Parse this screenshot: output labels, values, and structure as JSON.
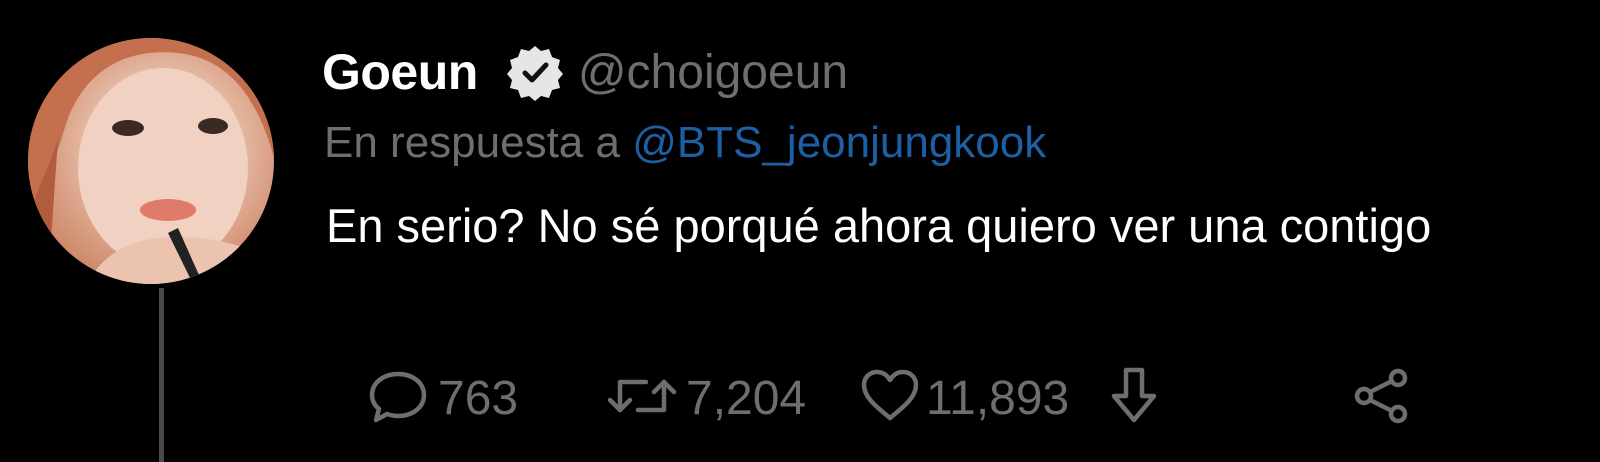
{
  "tweet": {
    "author": {
      "display_name": "Goeun",
      "handle": "@choigoeun",
      "verified": true
    },
    "reply_prefix": "En respuesta a",
    "reply_to": "@BTS_jeonjungkook",
    "text": "En serio? No sé porqué ahora quiero ver una contigo",
    "stats": {
      "replies": "763",
      "retweets": "7,204",
      "likes": "11,893"
    }
  },
  "colors": {
    "background": "#000000",
    "text": "#ffffff",
    "muted": "#6e6e6e",
    "link": "#1d5fa3"
  },
  "icons": [
    "verified-badge-icon",
    "reply-icon",
    "retweet-icon",
    "like-icon",
    "download-icon",
    "share-icon"
  ]
}
